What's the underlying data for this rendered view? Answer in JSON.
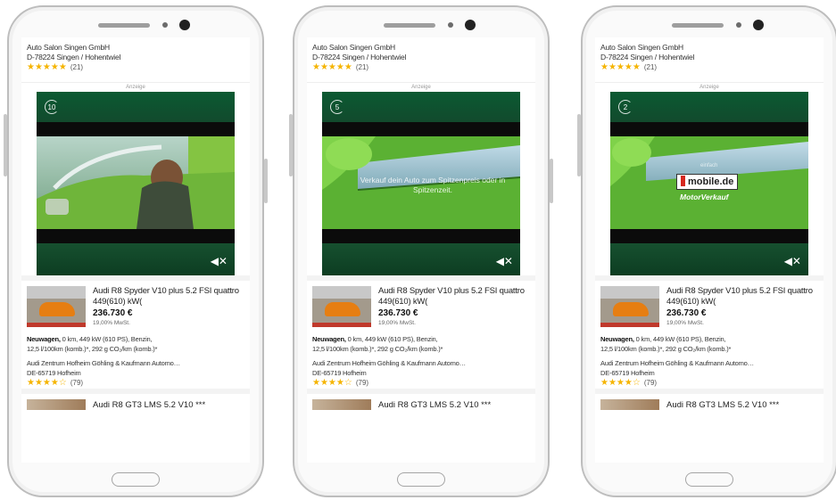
{
  "phones": [
    {
      "dealer": {
        "name": "Auto Salon Singen GmbH",
        "address": "D-78224 Singen / Hohentwiel",
        "rating_count": "(21)"
      },
      "ad_label": "Anzeige",
      "video": {
        "frame": "frame1",
        "countdown": "10",
        "overlay_text": "",
        "brand_small": "",
        "brand_logo": "",
        "brand_sub": ""
      },
      "listing": {
        "title": "Audi R8 Spyder V10 plus 5.2 FSI quattro 449(610) kW(",
        "price": "236.730 €",
        "vat": "19,00% MwSt.",
        "specs_bold": "Neuwagen,",
        "specs_line1": " 0 km, 449 kW (610 PS), Benzin,",
        "specs_line2": "12,5 l/100km (komb.)*, 292 g CO₂/km (komb.)*",
        "dealer_name": "Audi Zentrum Hofheim Göhling & Kaufmann Automo…",
        "dealer_location": "DE-65719 Hofheim",
        "rating_count": "(79)"
      },
      "next_listing": {
        "title": "Audi R8 GT3 LMS 5.2 V10 ***"
      }
    },
    {
      "dealer": {
        "name": "Auto Salon Singen GmbH",
        "address": "D-78224 Singen / Hohentwiel",
        "rating_count": "(21)"
      },
      "ad_label": "Anzeige",
      "video": {
        "frame": "frame2",
        "countdown": "5",
        "overlay_text": "Verkauf dein Auto zum Spitzenpreis oder in Spitzenzeit.",
        "brand_small": "",
        "brand_logo": "",
        "brand_sub": ""
      },
      "listing": {
        "title": "Audi R8 Spyder V10 plus 5.2 FSI quattro 449(610) kW(",
        "price": "236.730 €",
        "vat": "19,00% MwSt.",
        "specs_bold": "Neuwagen,",
        "specs_line1": " 0 km, 449 kW (610 PS), Benzin,",
        "specs_line2": "12,5 l/100km (komb.)*, 292 g CO₂/km (komb.)*",
        "dealer_name": "Audi Zentrum Hofheim Göhling & Kaufmann Automo…",
        "dealer_location": "DE-65719 Hofheim",
        "rating_count": "(79)"
      },
      "next_listing": {
        "title": "Audi R8 GT3 LMS 5.2 V10 ***"
      }
    },
    {
      "dealer": {
        "name": "Auto Salon Singen GmbH",
        "address": "D-78224 Singen / Hohentwiel",
        "rating_count": "(21)"
      },
      "ad_label": "Anzeige",
      "video": {
        "frame": "frame3",
        "countdown": "2",
        "overlay_text": "",
        "brand_small": "einfach",
        "brand_logo": "mobile.de",
        "brand_sub": "MotorVerkauf"
      },
      "listing": {
        "title": "Audi R8 Spyder V10 plus 5.2 FSI quattro 449(610) kW(",
        "price": "236.730 €",
        "vat": "19,00% MwSt.",
        "specs_bold": "Neuwagen,",
        "specs_line1": " 0 km, 449 kW (610 PS), Benzin,",
        "specs_line2": "12,5 l/100km (komb.)*, 292 g CO₂/km (komb.)*",
        "dealer_name": "Audi Zentrum Hofheim Göhling & Kaufmann Automo…",
        "dealer_location": "DE-65719 Hofheim",
        "rating_count": "(79)"
      },
      "next_listing": {
        "title": "Audi R8 GT3 LMS 5.2 V10 ***"
      }
    }
  ],
  "dealer_rating": {
    "stars_filled": 5,
    "stars_total": 5
  },
  "listing_rating": {
    "stars_filled": 4,
    "stars_total": 5
  },
  "icons": {
    "mute": "speaker-mute-icon",
    "star": "star-icon",
    "countdown": "countdown-ring-icon"
  },
  "colors": {
    "ad_green": "#7ac843",
    "star": "#f5b400",
    "dark_band": "#0e3d25"
  }
}
